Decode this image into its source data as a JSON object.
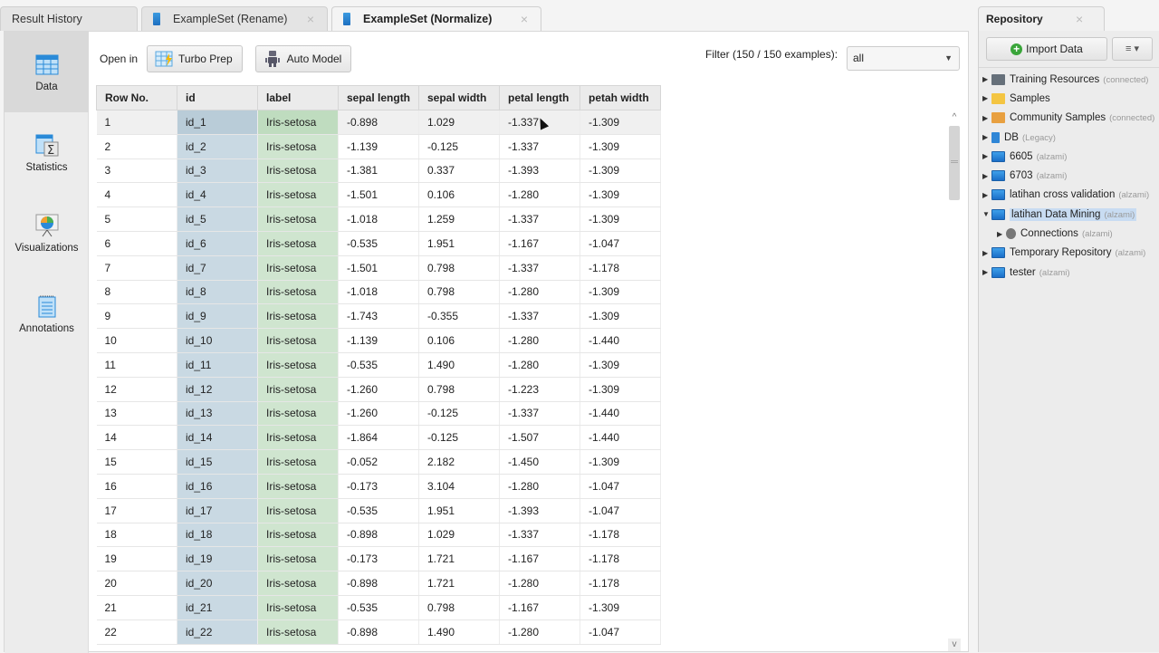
{
  "tabs": [
    {
      "label": "Result History",
      "active": false,
      "closable": false
    },
    {
      "label": "ExampleSet (Rename)",
      "active": false,
      "closable": true
    },
    {
      "label": "ExampleSet (Normalize)",
      "active": true,
      "closable": true
    }
  ],
  "close_glyph": "×",
  "sidebar": {
    "items": [
      {
        "label": "Data",
        "icon": "table-icon",
        "active": true
      },
      {
        "label": "Statistics",
        "icon": "statistics-sigma-icon",
        "active": false
      },
      {
        "label": "Visualizations",
        "icon": "pie-chart-easel-icon",
        "active": false
      },
      {
        "label": "Annotations",
        "icon": "notepad-icon",
        "active": false
      }
    ]
  },
  "toolbar": {
    "open_in_label": "Open in",
    "turbo_prep_label": "Turbo Prep",
    "auto_model_label": "Auto Model",
    "filter_label": "Filter (150 / 150 examples):",
    "filter_value": "all",
    "dropdown_glyph": "▼"
  },
  "table": {
    "columns": [
      "Row No.",
      "id",
      "label",
      "sepal length",
      "sepal width",
      "petal length",
      "petah width"
    ],
    "rows": [
      [
        "1",
        "id_1",
        "Iris-setosa",
        "-0.898",
        "1.029",
        "-1.337",
        "-1.309"
      ],
      [
        "2",
        "id_2",
        "Iris-setosa",
        "-1.139",
        "-0.125",
        "-1.337",
        "-1.309"
      ],
      [
        "3",
        "id_3",
        "Iris-setosa",
        "-1.381",
        "0.337",
        "-1.393",
        "-1.309"
      ],
      [
        "4",
        "id_4",
        "Iris-setosa",
        "-1.501",
        "0.106",
        "-1.280",
        "-1.309"
      ],
      [
        "5",
        "id_5",
        "Iris-setosa",
        "-1.018",
        "1.259",
        "-1.337",
        "-1.309"
      ],
      [
        "6",
        "id_6",
        "Iris-setosa",
        "-0.535",
        "1.951",
        "-1.167",
        "-1.047"
      ],
      [
        "7",
        "id_7",
        "Iris-setosa",
        "-1.501",
        "0.798",
        "-1.337",
        "-1.178"
      ],
      [
        "8",
        "id_8",
        "Iris-setosa",
        "-1.018",
        "0.798",
        "-1.280",
        "-1.309"
      ],
      [
        "9",
        "id_9",
        "Iris-setosa",
        "-1.743",
        "-0.355",
        "-1.337",
        "-1.309"
      ],
      [
        "10",
        "id_10",
        "Iris-setosa",
        "-1.139",
        "0.106",
        "-1.280",
        "-1.440"
      ],
      [
        "11",
        "id_11",
        "Iris-setosa",
        "-0.535",
        "1.490",
        "-1.280",
        "-1.309"
      ],
      [
        "12",
        "id_12",
        "Iris-setosa",
        "-1.260",
        "0.798",
        "-1.223",
        "-1.309"
      ],
      [
        "13",
        "id_13",
        "Iris-setosa",
        "-1.260",
        "-0.125",
        "-1.337",
        "-1.440"
      ],
      [
        "14",
        "id_14",
        "Iris-setosa",
        "-1.864",
        "-0.125",
        "-1.507",
        "-1.440"
      ],
      [
        "15",
        "id_15",
        "Iris-setosa",
        "-0.052",
        "2.182",
        "-1.450",
        "-1.309"
      ],
      [
        "16",
        "id_16",
        "Iris-setosa",
        "-0.173",
        "3.104",
        "-1.280",
        "-1.047"
      ],
      [
        "17",
        "id_17",
        "Iris-setosa",
        "-0.535",
        "1.951",
        "-1.393",
        "-1.047"
      ],
      [
        "18",
        "id_18",
        "Iris-setosa",
        "-0.898",
        "1.029",
        "-1.337",
        "-1.178"
      ],
      [
        "19",
        "id_19",
        "Iris-setosa",
        "-0.173",
        "1.721",
        "-1.167",
        "-1.178"
      ],
      [
        "20",
        "id_20",
        "Iris-setosa",
        "-0.898",
        "1.721",
        "-1.280",
        "-1.178"
      ],
      [
        "21",
        "id_21",
        "Iris-setosa",
        "-0.535",
        "0.798",
        "-1.167",
        "-1.309"
      ],
      [
        "22",
        "id_22",
        "Iris-setosa",
        "-0.898",
        "1.490",
        "-1.280",
        "-1.047"
      ]
    ],
    "selected_row": 0
  },
  "scrollbar": {
    "up_glyph": "^",
    "down_glyph": "v"
  },
  "repository": {
    "title": "Repository",
    "import_label": "Import Data",
    "plus_glyph": "+",
    "menu_glyph": "≡ ▾",
    "tree": [
      {
        "label": "Training Resources",
        "sub": "(connected)",
        "icon": "graduation-cap-icon",
        "cls": "ic-grad",
        "expanded": false,
        "child": false,
        "selected": false
      },
      {
        "label": "Samples",
        "sub": "",
        "icon": "folder-icon",
        "cls": "ic-folder",
        "expanded": false,
        "child": false,
        "selected": false
      },
      {
        "label": "Community Samples",
        "sub": "(connected)",
        "icon": "people-icon",
        "cls": "ic-people",
        "expanded": false,
        "child": false,
        "selected": false
      },
      {
        "label": "DB",
        "sub": "(Legacy)",
        "icon": "database-icon",
        "cls": "ic-db",
        "expanded": false,
        "child": false,
        "selected": false
      },
      {
        "label": "6605",
        "sub": "(alzami)",
        "icon": "monitor-icon",
        "cls": "ic-monitor",
        "expanded": false,
        "child": false,
        "selected": false
      },
      {
        "label": "6703",
        "sub": "(alzami)",
        "icon": "monitor-icon",
        "cls": "ic-monitor",
        "expanded": false,
        "child": false,
        "selected": false
      },
      {
        "label": "latihan cross validation",
        "sub": "(alzami)",
        "icon": "monitor-icon",
        "cls": "ic-monitor",
        "expanded": false,
        "child": false,
        "selected": false
      },
      {
        "label": "latihan Data Mining",
        "sub": "(alzami)",
        "icon": "monitor-icon",
        "cls": "ic-monitor",
        "expanded": true,
        "child": false,
        "selected": true
      },
      {
        "label": "Connections",
        "sub": "(alzami)",
        "icon": "plug-icon",
        "cls": "ic-plug",
        "expanded": false,
        "child": true,
        "selected": false
      },
      {
        "label": "Temporary Repository",
        "sub": "(alzami)",
        "icon": "monitor-icon",
        "cls": "ic-monitor",
        "expanded": false,
        "child": false,
        "selected": false
      },
      {
        "label": "tester",
        "sub": "(alzami)",
        "icon": "monitor-icon",
        "cls": "ic-monitor",
        "expanded": false,
        "child": false,
        "selected": false
      }
    ],
    "collapsed_glyph": "▶",
    "expanded_glyph": "▼"
  }
}
